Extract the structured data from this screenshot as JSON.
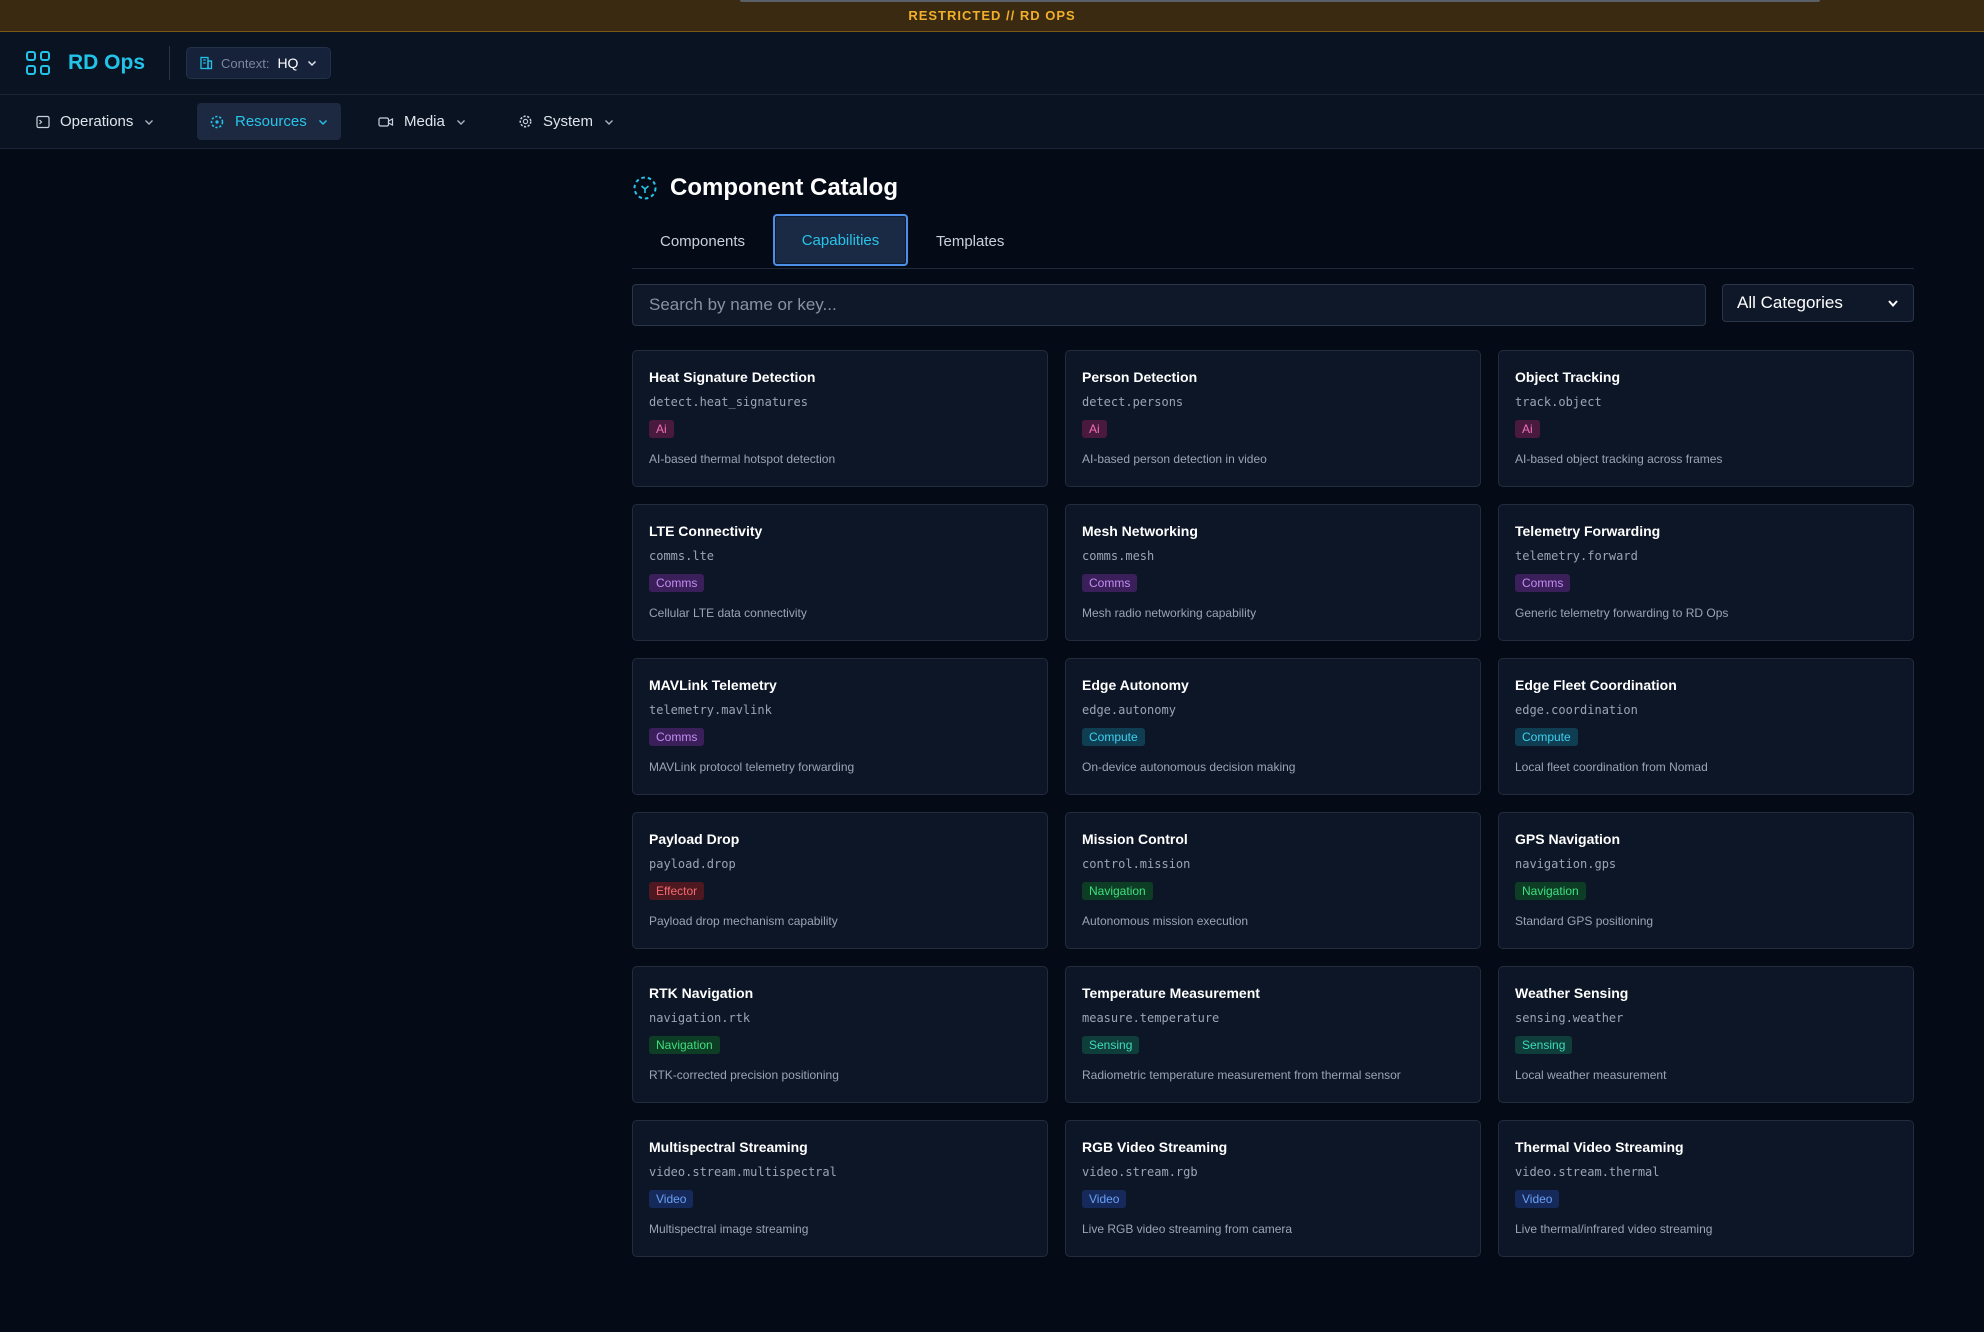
{
  "banner": {
    "text": "RESTRICTED // RD OPS"
  },
  "header": {
    "brand": "RD Ops",
    "context_label": "Context:",
    "context_value": "HQ"
  },
  "nav": {
    "items": [
      {
        "label": "Operations",
        "icon": "terminal-icon"
      },
      {
        "label": "Resources",
        "icon": "cog-dashed-icon",
        "active": true
      },
      {
        "label": "Media",
        "icon": "video-icon"
      },
      {
        "label": "System",
        "icon": "gear-icon"
      }
    ]
  },
  "main": {
    "title": "Component Catalog",
    "tabs": [
      {
        "label": "Components"
      },
      {
        "label": "Capabilities",
        "active": true
      },
      {
        "label": "Templates"
      }
    ],
    "search_placeholder": "Search by name or key...",
    "category_select": "All Categories"
  },
  "badge_colors": {
    "Ai": {
      "bg": "#4a1a3e",
      "fg": "#f070b8"
    },
    "Comms": {
      "bg": "#3a1f5a",
      "fg": "#c58cf4"
    },
    "Compute": {
      "bg": "#0f3d52",
      "fg": "#3ed0f0"
    },
    "Effector": {
      "bg": "#4d1820",
      "fg": "#f56a70"
    },
    "Navigation": {
      "bg": "#0e3d25",
      "fg": "#3ee07e"
    },
    "Sensing": {
      "bg": "#0e3d3a",
      "fg": "#3edcbc"
    },
    "Video": {
      "bg": "#152a5a",
      "fg": "#6aa0f6"
    }
  },
  "cards": [
    {
      "name": "Heat Signature Detection",
      "key": "detect.heat_signatures",
      "badge": "Ai",
      "desc": "AI-based thermal hotspot detection"
    },
    {
      "name": "Person Detection",
      "key": "detect.persons",
      "badge": "Ai",
      "desc": "AI-based person detection in video"
    },
    {
      "name": "Object Tracking",
      "key": "track.object",
      "badge": "Ai",
      "desc": "AI-based object tracking across frames"
    },
    {
      "name": "LTE Connectivity",
      "key": "comms.lte",
      "badge": "Comms",
      "desc": "Cellular LTE data connectivity"
    },
    {
      "name": "Mesh Networking",
      "key": "comms.mesh",
      "badge": "Comms",
      "desc": "Mesh radio networking capability"
    },
    {
      "name": "Telemetry Forwarding",
      "key": "telemetry.forward",
      "badge": "Comms",
      "desc": "Generic telemetry forwarding to RD Ops"
    },
    {
      "name": "MAVLink Telemetry",
      "key": "telemetry.mavlink",
      "badge": "Comms",
      "desc": "MAVLink protocol telemetry forwarding"
    },
    {
      "name": "Edge Autonomy",
      "key": "edge.autonomy",
      "badge": "Compute",
      "desc": "On-device autonomous decision making"
    },
    {
      "name": "Edge Fleet Coordination",
      "key": "edge.coordination",
      "badge": "Compute",
      "desc": "Local fleet coordination from Nomad"
    },
    {
      "name": "Payload Drop",
      "key": "payload.drop",
      "badge": "Effector",
      "desc": "Payload drop mechanism capability"
    },
    {
      "name": "Mission Control",
      "key": "control.mission",
      "badge": "Navigation",
      "desc": "Autonomous mission execution"
    },
    {
      "name": "GPS Navigation",
      "key": "navigation.gps",
      "badge": "Navigation",
      "desc": "Standard GPS positioning"
    },
    {
      "name": "RTK Navigation",
      "key": "navigation.rtk",
      "badge": "Navigation",
      "desc": "RTK-corrected precision positioning"
    },
    {
      "name": "Temperature Measurement",
      "key": "measure.temperature",
      "badge": "Sensing",
      "desc": "Radiometric temperature measurement from thermal sensor"
    },
    {
      "name": "Weather Sensing",
      "key": "sensing.weather",
      "badge": "Sensing",
      "desc": "Local weather measurement"
    },
    {
      "name": "Multispectral Streaming",
      "key": "video.stream.multispectral",
      "badge": "Video",
      "desc": "Multispectral image streaming"
    },
    {
      "name": "RGB Video Streaming",
      "key": "video.stream.rgb",
      "badge": "Video",
      "desc": "Live RGB video streaming from camera"
    },
    {
      "name": "Thermal Video Streaming",
      "key": "video.stream.thermal",
      "badge": "Video",
      "desc": "Live thermal/infrared video streaming"
    }
  ]
}
